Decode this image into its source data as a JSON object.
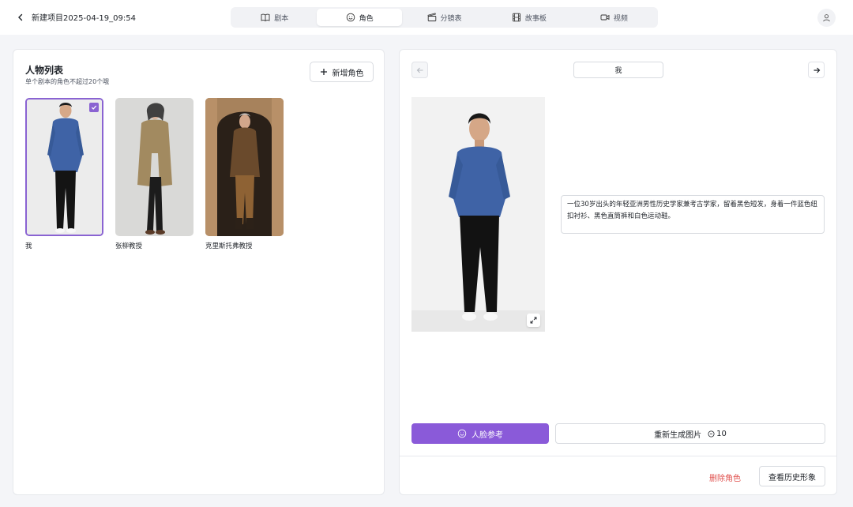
{
  "header": {
    "project_title": "新建项目2025-04-19_09:54",
    "tabs": [
      {
        "label": "剧本",
        "icon": "book-icon"
      },
      {
        "label": "角色",
        "icon": "smile-icon"
      },
      {
        "label": "分镜表",
        "icon": "clapperboard-icon"
      },
      {
        "label": "故事板",
        "icon": "film-icon"
      },
      {
        "label": "视频",
        "icon": "video-icon"
      }
    ],
    "active_tab": "角色"
  },
  "character_list": {
    "title": "人物列表",
    "subtitle": "单个剧本的角色不超过20个哦",
    "add_label": "新增角色",
    "characters": [
      {
        "name": "我",
        "selected": true
      },
      {
        "name": "张柳教授",
        "selected": false
      },
      {
        "name": "克里斯托弗教授",
        "selected": false
      }
    ]
  },
  "detail": {
    "name_value": "我",
    "description": "一位30岁出头的年轻亚洲男性历史学家兼考古学家，留着黑色短发，身着一件蓝色纽扣衬衫、黑色直筒裤和白色运动鞋。",
    "face_ref_label": "人脸参考",
    "regen_label": "重新生成图片",
    "regen_cost": "10",
    "delete_label": "删除角色",
    "history_label": "查看历史形象"
  },
  "colors": {
    "accent": "#8a5ad9",
    "danger": "#e0504d"
  }
}
